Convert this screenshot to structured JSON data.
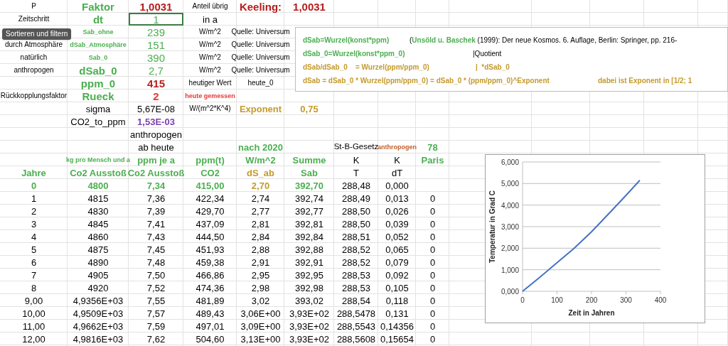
{
  "sheet": {
    "rows": [
      [
        {
          "text": "P",
          "kind": "small",
          "selected": false
        },
        {
          "text": "Faktor",
          "kind": "green-large",
          "selected": false
        },
        {
          "text": "1,0031",
          "kind": "red-large",
          "selected": false
        },
        {
          "text": "Anteil übrig",
          "kind": "small",
          "selected": false
        },
        {
          "text": "Keeling:",
          "kind": "red-large",
          "selected": false
        },
        {
          "text": "1,0031",
          "kind": "red-large",
          "selected": false
        },
        null,
        null,
        null
      ],
      [
        {
          "text": "Zeitschritt",
          "kind": "small",
          "selected": false
        },
        {
          "text": "dt",
          "kind": "green-large",
          "selected": false
        },
        {
          "text": "1",
          "kind": "green-value",
          "selected": true
        },
        {
          "text": "in a",
          "kind": "plain",
          "selected": false
        },
        null,
        null,
        null,
        null,
        null
      ],
      [
        null,
        {
          "text": "Sab_ohne",
          "kind": "green-small",
          "selected": false
        },
        {
          "text": "239",
          "kind": "green-value",
          "selected": false
        },
        {
          "text": "W/m^2",
          "kind": "small",
          "selected": false
        },
        {
          "text": "Quelle: Universum",
          "kind": "small",
          "selected": false
        },
        null,
        null,
        null,
        null
      ],
      [
        {
          "text": "durch Atmosphäre",
          "kind": "small",
          "selected": false
        },
        {
          "text": "dSab_Atmosphäre",
          "kind": "green-small",
          "selected": false
        },
        {
          "text": "151",
          "kind": "green-value",
          "selected": false
        },
        {
          "text": "W/m^2",
          "kind": "small",
          "selected": false
        },
        {
          "text": "Quelle: Universum",
          "kind": "small",
          "selected": false
        },
        null,
        null,
        null,
        null
      ],
      [
        {
          "text": "natürlich",
          "kind": "small",
          "selected": false
        },
        {
          "text": "Sab_0",
          "kind": "green-small",
          "selected": false
        },
        {
          "text": "390",
          "kind": "green-value",
          "selected": false
        },
        {
          "text": "W/m^2",
          "kind": "small",
          "selected": false
        },
        {
          "text": "Quelle: Universum",
          "kind": "small",
          "selected": false
        },
        null,
        null,
        null,
        null
      ],
      [
        {
          "text": "anthropogen",
          "kind": "small",
          "selected": false
        },
        {
          "text": "dSab_0",
          "kind": "green-large",
          "selected": false
        },
        {
          "text": "2,7",
          "kind": "green-value",
          "selected": false
        },
        {
          "text": "W/m^2",
          "kind": "small",
          "selected": false
        },
        {
          "text": "Quelle: Universum",
          "kind": "small",
          "selected": false
        },
        null,
        null,
        null,
        null
      ],
      [
        null,
        {
          "text": "ppm_0",
          "kind": "green-large",
          "selected": false
        },
        {
          "text": "415",
          "kind": "red-large",
          "selected": false
        },
        {
          "text": "heutiger Wert",
          "kind": "small",
          "selected": false
        },
        {
          "text": "heute_0",
          "kind": "small",
          "selected": false
        },
        null,
        null,
        null,
        null
      ],
      [
        {
          "text": "Rückkopplungsfaktor",
          "kind": "small",
          "selected": false
        },
        {
          "text": "Rueck",
          "kind": "green-large",
          "selected": false
        },
        {
          "text": "2",
          "kind": "red-bright",
          "selected": false
        },
        {
          "text": "heute gemessen",
          "kind": "red-small",
          "selected": false
        },
        null,
        null,
        null,
        null,
        null
      ],
      [
        null,
        {
          "text": "sigma",
          "kind": "plain",
          "selected": false
        },
        {
          "text": "5,67E-08",
          "kind": "plain",
          "selected": false
        },
        {
          "text": "W/(m^2*K^4)",
          "kind": "small",
          "selected": false
        },
        {
          "text": "Exponent",
          "kind": "gold",
          "selected": false
        },
        {
          "text": "0,75",
          "kind": "gold",
          "selected": false
        },
        null,
        null,
        null
      ],
      [
        null,
        {
          "text": "CO2_to_ppm",
          "kind": "plain",
          "selected": false
        },
        {
          "text": "1,53E-03",
          "kind": "purple",
          "selected": false
        },
        null,
        null,
        null,
        null,
        null,
        null
      ],
      [
        null,
        null,
        {
          "text": "anthropogen",
          "kind": "plain",
          "selected": false
        },
        null,
        null,
        null,
        null,
        null,
        null
      ],
      [
        null,
        null,
        {
          "text": "ab heute",
          "kind": "plain",
          "selected": false
        },
        null,
        {
          "text": "nach 2020",
          "kind": "green-heading",
          "selected": false
        },
        null,
        {
          "text": "St-B-Gesetz",
          "kind": "plain-narrow",
          "selected": false
        },
        {
          "text": "anthropogen",
          "kind": "orange-small",
          "selected": false
        },
        {
          "text": "78",
          "kind": "green-heading",
          "selected": false
        }
      ],
      [
        null,
        {
          "text": "kg pro Mensch und a",
          "kind": "green-small",
          "selected": false
        },
        {
          "text": "ppm je a",
          "kind": "green-heading",
          "selected": false
        },
        {
          "text": "ppm(t)",
          "kind": "green-heading",
          "selected": false
        },
        {
          "text": "W/m^2",
          "kind": "green-heading",
          "selected": false
        },
        {
          "text": "Summe",
          "kind": "green-heading",
          "selected": false
        },
        {
          "text": "K",
          "kind": "plain",
          "selected": false
        },
        {
          "text": "K",
          "kind": "plain",
          "selected": false
        },
        {
          "text": "Paris",
          "kind": "green-heading",
          "selected": false
        }
      ],
      [
        {
          "text": "Jahre",
          "kind": "green-heading",
          "selected": false
        },
        {
          "text": "Co2 Ausstoß",
          "kind": "green-heading",
          "selected": false
        },
        {
          "text": "Co2 Ausstoß",
          "kind": "green-heading",
          "selected": false
        },
        {
          "text": "CO2",
          "kind": "green-heading",
          "selected": false
        },
        {
          "text": "dS_ab",
          "kind": "gold",
          "selected": false
        },
        {
          "text": "Sab",
          "kind": "green-heading",
          "selected": false
        },
        {
          "text": "T",
          "kind": "plain",
          "selected": false
        },
        {
          "text": "dT",
          "kind": "plain",
          "selected": false
        },
        null
      ],
      [
        {
          "text": "0",
          "kind": "green-heading",
          "selected": false
        },
        {
          "text": "4800",
          "kind": "green-heading",
          "selected": false
        },
        {
          "text": "7,34",
          "kind": "green-heading",
          "selected": false
        },
        {
          "text": "415,00",
          "kind": "green-heading",
          "selected": false
        },
        {
          "text": "2,70",
          "kind": "gold",
          "selected": false
        },
        {
          "text": "392,70",
          "kind": "green-heading",
          "selected": false
        },
        {
          "text": "288,48",
          "kind": "plain",
          "selected": false
        },
        {
          "text": "0,000",
          "kind": "plain",
          "selected": false
        },
        null
      ],
      [
        {
          "text": "1",
          "kind": "plain",
          "selected": false
        },
        {
          "text": "4815",
          "kind": "plain",
          "selected": false
        },
        {
          "text": "7,36",
          "kind": "plain",
          "selected": false
        },
        {
          "text": "422,34",
          "kind": "plain",
          "selected": false
        },
        {
          "text": "2,74",
          "kind": "plain",
          "selected": false
        },
        {
          "text": "392,74",
          "kind": "plain",
          "selected": false
        },
        {
          "text": "288,49",
          "kind": "plain",
          "selected": false
        },
        {
          "text": "0,013",
          "kind": "plain",
          "selected": false
        },
        {
          "text": "0",
          "kind": "plain",
          "selected": false
        }
      ],
      [
        {
          "text": "2",
          "kind": "plain",
          "selected": false
        },
        {
          "text": "4830",
          "kind": "plain",
          "selected": false
        },
        {
          "text": "7,39",
          "kind": "plain",
          "selected": false
        },
        {
          "text": "429,70",
          "kind": "plain",
          "selected": false
        },
        {
          "text": "2,77",
          "kind": "plain",
          "selected": false
        },
        {
          "text": "392,77",
          "kind": "plain",
          "selected": false
        },
        {
          "text": "288,50",
          "kind": "plain",
          "selected": false
        },
        {
          "text": "0,026",
          "kind": "plain",
          "selected": false
        },
        {
          "text": "0",
          "kind": "plain",
          "selected": false
        }
      ],
      [
        {
          "text": "3",
          "kind": "plain",
          "selected": false
        },
        {
          "text": "4845",
          "kind": "plain",
          "selected": false
        },
        {
          "text": "7,41",
          "kind": "plain",
          "selected": false
        },
        {
          "text": "437,09",
          "kind": "plain",
          "selected": false
        },
        {
          "text": "2,81",
          "kind": "plain",
          "selected": false
        },
        {
          "text": "392,81",
          "kind": "plain",
          "selected": false
        },
        {
          "text": "288,50",
          "kind": "plain",
          "selected": false
        },
        {
          "text": "0,039",
          "kind": "plain",
          "selected": false
        },
        {
          "text": "0",
          "kind": "plain",
          "selected": false
        }
      ],
      [
        {
          "text": "4",
          "kind": "plain",
          "selected": false
        },
        {
          "text": "4860",
          "kind": "plain",
          "selected": false
        },
        {
          "text": "7,43",
          "kind": "plain",
          "selected": false
        },
        {
          "text": "444,50",
          "kind": "plain",
          "selected": false
        },
        {
          "text": "2,84",
          "kind": "plain",
          "selected": false
        },
        {
          "text": "392,84",
          "kind": "plain",
          "selected": false
        },
        {
          "text": "288,51",
          "kind": "plain",
          "selected": false
        },
        {
          "text": "0,052",
          "kind": "plain",
          "selected": false
        },
        {
          "text": "0",
          "kind": "plain",
          "selected": false
        }
      ],
      [
        {
          "text": "5",
          "kind": "plain",
          "selected": false
        },
        {
          "text": "4875",
          "kind": "plain",
          "selected": false
        },
        {
          "text": "7,45",
          "kind": "plain",
          "selected": false
        },
        {
          "text": "451,93",
          "kind": "plain",
          "selected": false
        },
        {
          "text": "2,88",
          "kind": "plain",
          "selected": false
        },
        {
          "text": "392,88",
          "kind": "plain",
          "selected": false
        },
        {
          "text": "288,52",
          "kind": "plain",
          "selected": false
        },
        {
          "text": "0,065",
          "kind": "plain",
          "selected": false
        },
        {
          "text": "0",
          "kind": "plain",
          "selected": false
        }
      ],
      [
        {
          "text": "6",
          "kind": "plain",
          "selected": false
        },
        {
          "text": "4890",
          "kind": "plain",
          "selected": false
        },
        {
          "text": "7,48",
          "kind": "plain",
          "selected": false
        },
        {
          "text": "459,38",
          "kind": "plain",
          "selected": false
        },
        {
          "text": "2,91",
          "kind": "plain",
          "selected": false
        },
        {
          "text": "392,91",
          "kind": "plain",
          "selected": false
        },
        {
          "text": "288,52",
          "kind": "plain",
          "selected": false
        },
        {
          "text": "0,079",
          "kind": "plain",
          "selected": false
        },
        {
          "text": "0",
          "kind": "plain",
          "selected": false
        }
      ],
      [
        {
          "text": "7",
          "kind": "plain",
          "selected": false
        },
        {
          "text": "4905",
          "kind": "plain",
          "selected": false
        },
        {
          "text": "7,50",
          "kind": "plain",
          "selected": false
        },
        {
          "text": "466,86",
          "kind": "plain",
          "selected": false
        },
        {
          "text": "2,95",
          "kind": "plain",
          "selected": false
        },
        {
          "text": "392,95",
          "kind": "plain",
          "selected": false
        },
        {
          "text": "288,53",
          "kind": "plain",
          "selected": false
        },
        {
          "text": "0,092",
          "kind": "plain",
          "selected": false
        },
        {
          "text": "0",
          "kind": "plain",
          "selected": false
        }
      ],
      [
        {
          "text": "8",
          "kind": "plain",
          "selected": false
        },
        {
          "text": "4920",
          "kind": "plain",
          "selected": false
        },
        {
          "text": "7,52",
          "kind": "plain",
          "selected": false
        },
        {
          "text": "474,36",
          "kind": "plain",
          "selected": false
        },
        {
          "text": "2,98",
          "kind": "plain",
          "selected": false
        },
        {
          "text": "392,98",
          "kind": "plain",
          "selected": false
        },
        {
          "text": "288,53",
          "kind": "plain",
          "selected": false
        },
        {
          "text": "0,105",
          "kind": "plain",
          "selected": false
        },
        {
          "text": "0",
          "kind": "plain",
          "selected": false
        }
      ],
      [
        {
          "text": "9,00",
          "kind": "plain",
          "selected": false
        },
        {
          "text": "4,9356E+03",
          "kind": "plain",
          "selected": false
        },
        {
          "text": "7,55",
          "kind": "plain",
          "selected": false
        },
        {
          "text": "481,89",
          "kind": "plain",
          "selected": false
        },
        {
          "text": "3,02",
          "kind": "plain",
          "selected": false
        },
        {
          "text": "393,02",
          "kind": "plain",
          "selected": false
        },
        {
          "text": "288,54",
          "kind": "plain",
          "selected": false
        },
        {
          "text": "0,118",
          "kind": "plain",
          "selected": false
        },
        {
          "text": "0",
          "kind": "plain",
          "selected": false
        }
      ],
      [
        {
          "text": "10,00",
          "kind": "plain",
          "selected": false
        },
        {
          "text": "4,9509E+03",
          "kind": "plain",
          "selected": false
        },
        {
          "text": "7,57",
          "kind": "plain",
          "selected": false
        },
        {
          "text": "489,43",
          "kind": "plain",
          "selected": false
        },
        {
          "text": "3,06E+00",
          "kind": "plain",
          "selected": false
        },
        {
          "text": "3,93E+02",
          "kind": "plain",
          "selected": false
        },
        {
          "text": "288,5478",
          "kind": "plain",
          "selected": false
        },
        {
          "text": "0,131",
          "kind": "plain",
          "selected": false
        },
        {
          "text": "0",
          "kind": "plain",
          "selected": false
        }
      ],
      [
        {
          "text": "11,00",
          "kind": "plain",
          "selected": false
        },
        {
          "text": "4,9662E+03",
          "kind": "plain",
          "selected": false
        },
        {
          "text": "7,59",
          "kind": "plain",
          "selected": false
        },
        {
          "text": "497,01",
          "kind": "plain",
          "selected": false
        },
        {
          "text": "3,09E+00",
          "kind": "plain",
          "selected": false
        },
        {
          "text": "3,93E+02",
          "kind": "plain",
          "selected": false
        },
        {
          "text": "288,5543",
          "kind": "plain",
          "selected": false
        },
        {
          "text": "0,14356",
          "kind": "plain",
          "selected": false
        },
        {
          "text": "0",
          "kind": "plain",
          "selected": false
        }
      ],
      [
        {
          "text": "12,00",
          "kind": "plain",
          "selected": false
        },
        {
          "text": "4,9816E+03",
          "kind": "plain",
          "selected": false
        },
        {
          "text": "7,62",
          "kind": "plain",
          "selected": false
        },
        {
          "text": "504,60",
          "kind": "plain",
          "selected": false
        },
        {
          "text": "3,13E+00",
          "kind": "plain",
          "selected": false
        },
        {
          "text": "3,93E+02",
          "kind": "plain",
          "selected": false
        },
        {
          "text": "288,5608",
          "kind": "plain",
          "selected": false
        },
        {
          "text": "0,15654",
          "kind": "plain",
          "selected": false
        },
        {
          "text": "0",
          "kind": "plain",
          "selected": false
        }
      ]
    ]
  },
  "tooltip": {
    "text": "Sortieren und filtern"
  },
  "text_box": {
    "lines": [
      {
        "segments": [
          {
            "parts": [
              {
                "text": "dSab=Wurzel(konst*ppm)",
                "kind": "green"
              }
            ]
          },
          {
            "parts": [
              {
                "text": "(",
                "kind": "black"
              },
              {
                "text": "Unsöld u. Baschek",
                "kind": "green"
              },
              {
                "text": " (1999): Der neue Kosmos. 6. Auflage, Berlin: Springer, pp. 216-",
                "kind": "black"
              }
            ]
          }
        ]
      },
      {
        "segments": [
          {
            "parts": [
              {
                "text": "dSab_0=Wurzel(konst*ppm_0)",
                "kind": "green"
              }
            ]
          },
          {
            "parts": [
              {
                "text": "|Quotient",
                "kind": "black"
              }
            ]
          }
        ]
      },
      {
        "segments": [
          {
            "parts": [
              {
                "text": "dSab/dSab_0    = Wurzel(ppm/ppm_0)",
                "kind": "gold"
              }
            ]
          },
          {
            "parts": [
              {
                "text": "|  *dSab_0",
                "kind": "gold"
              }
            ]
          }
        ]
      },
      {
        "segments": [
          {
            "parts": [
              {
                "text": "dSab = dSab_0 * Wurzel(ppm/ppm_0) = dSab_0 * (ppm/ppm_0)^Exponent",
                "kind": "gold"
              }
            ]
          },
          {
            "parts": [
              {
                "text": "dabei ist Exponent in [1/2; 1",
                "kind": "gold"
              }
            ]
          }
        ]
      }
    ]
  },
  "chart": {
    "chart_data": {
      "type": "line",
      "xlabel": "Zeit in Jahren",
      "ylabel": "Temperatur in Grad C",
      "x": [
        0,
        50,
        100,
        150,
        200,
        250,
        300,
        340
      ],
      "grid": true,
      "series": [
        {
          "color": "#4472c4",
          "values": [
            0,
            0.65,
            1.33,
            2.0,
            2.76,
            3.6,
            4.45,
            5.15
          ]
        }
      ],
      "xlim": [
        0,
        400
      ],
      "ylim": [
        0,
        6
      ],
      "xticks": [
        0,
        100,
        200,
        300,
        400
      ],
      "yticks": [
        {
          "value": 0,
          "label": "0,000"
        },
        {
          "value": 1,
          "label": "1,000"
        },
        {
          "value": 2,
          "label": "2,000"
        },
        {
          "value": 3,
          "label": "3,000"
        },
        {
          "value": 4,
          "label": "4,000"
        },
        {
          "value": 5,
          "label": "5,000"
        },
        {
          "value": 6,
          "label": "6,000"
        }
      ]
    }
  }
}
